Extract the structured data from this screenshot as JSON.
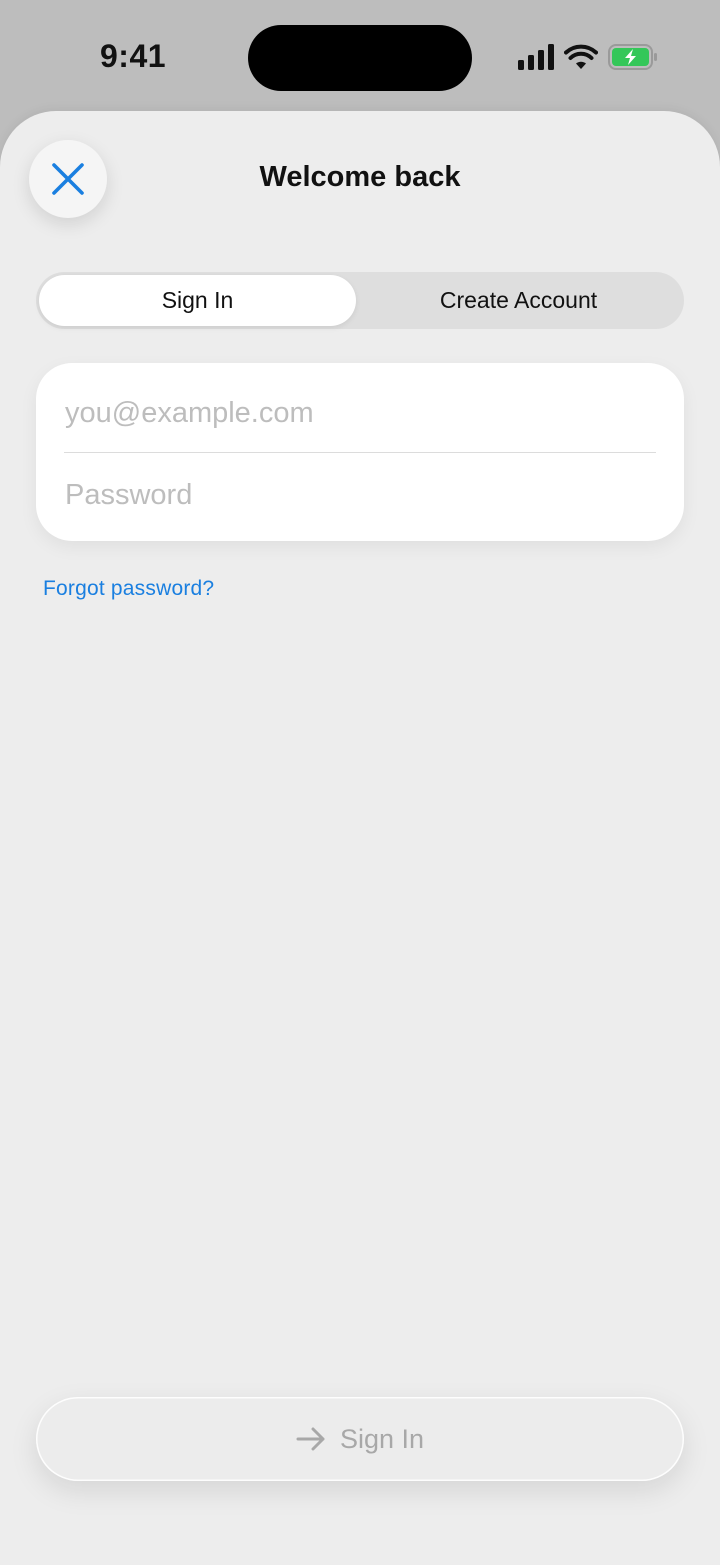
{
  "status_bar": {
    "time": "9:41"
  },
  "header": {
    "title": "Welcome back"
  },
  "segmented": {
    "sign_in": "Sign In",
    "create_account": "Create Account"
  },
  "form": {
    "email_placeholder": "you@example.com",
    "email_value": "",
    "password_placeholder": "Password",
    "password_value": ""
  },
  "forgot_password": "Forgot password?",
  "submit": {
    "label": "Sign In"
  },
  "colors": {
    "accent": "#1a7fe0",
    "battery": "#34c759",
    "disabled_text": "#a8a8a8"
  },
  "icons": {
    "close": "close-icon",
    "arrow": "arrow-right-icon",
    "signal": "cellular-signal-icon",
    "wifi": "wifi-icon",
    "battery": "battery-charging-icon"
  }
}
